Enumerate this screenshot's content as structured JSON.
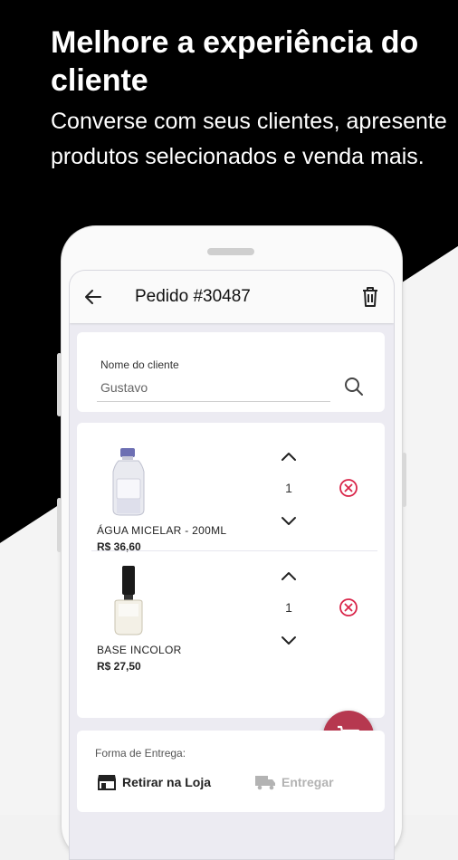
{
  "promo": {
    "headline": "Melhore a experiência do cliente",
    "subline": "Converse com seus clientes, apresente produtos selecionados e venda mais."
  },
  "appbar": {
    "title": "Pedido #30487",
    "back_icon": "arrow-left-icon",
    "delete_icon": "trash-icon"
  },
  "client": {
    "label": "Nome do cliente",
    "value": "Gustavo",
    "search_icon": "search-icon"
  },
  "items": [
    {
      "name": "ÁGUA MICELAR - 200ML",
      "price": "R$ 36,60",
      "quantity": "1",
      "image": "micellar-water-bottle"
    },
    {
      "name": "BASE INCOLOR",
      "price": "R$ 27,50",
      "quantity": "1",
      "image": "nail-polish-bottle"
    }
  ],
  "fab": {
    "icon": "add-to-cart-icon"
  },
  "delivery": {
    "label": "Forma de Entrega:",
    "options": [
      {
        "label": "Retirar na Loja",
        "icon": "store-icon",
        "selected": true
      },
      {
        "label": "Entregar",
        "icon": "truck-icon",
        "selected": false
      }
    ]
  },
  "colors": {
    "accent": "#b6384f",
    "remove": "#d9264a",
    "screen_bg": "#ecebf2"
  }
}
